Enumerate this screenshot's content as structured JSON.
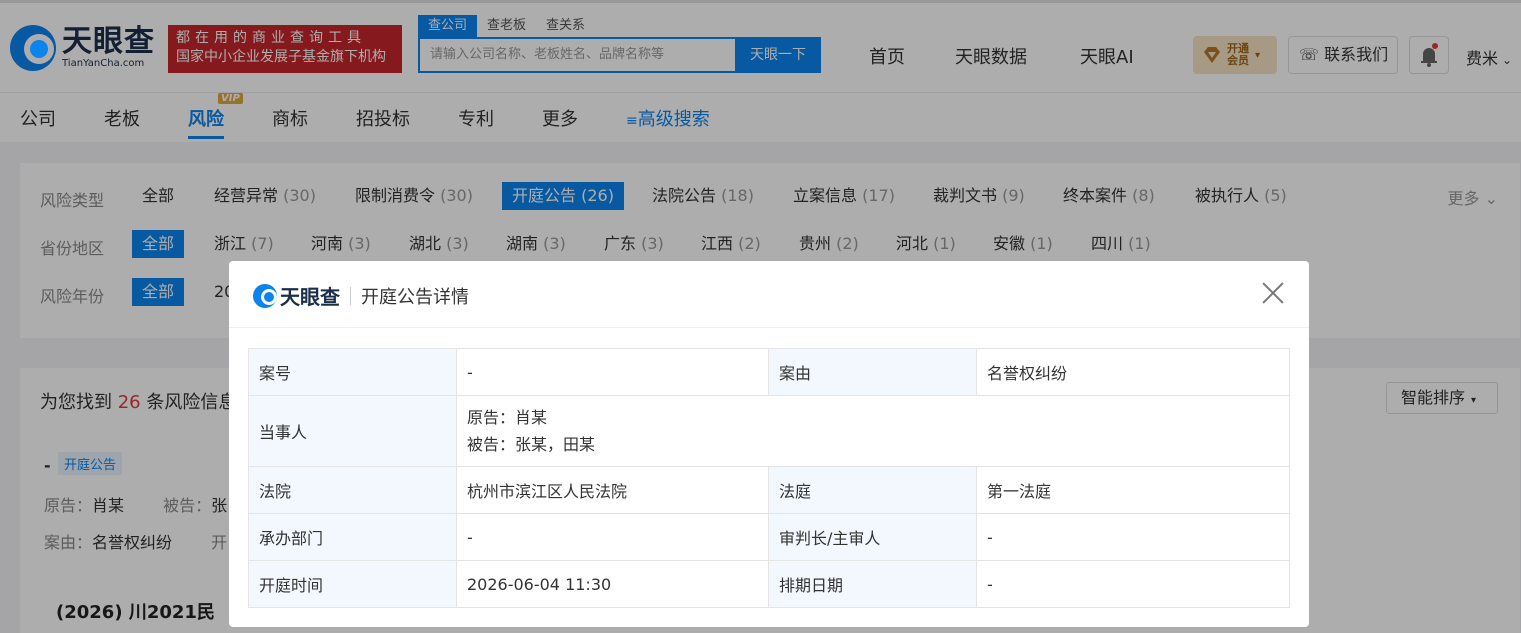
{
  "header": {
    "logo_cn": "天眼查",
    "logo_en": "TianYanCha.com",
    "slogan_line1": "都在用的商业查询工具",
    "slogan_line2": "国家中小企业发展子基金旗下机构",
    "search_tabs": [
      "查公司",
      "查老板",
      "查关系"
    ],
    "search_placeholder": "请输入公司名称、老板姓名、品牌名称等",
    "search_button": "天眼一下",
    "nav": [
      "首页",
      "天眼数据",
      "天眼AI"
    ],
    "vip_line1": "开通",
    "vip_line2": "会员",
    "contact": "联系我们",
    "user": "费米"
  },
  "subnav": {
    "items": [
      "公司",
      "老板",
      "风险",
      "商标",
      "招投标",
      "专利",
      "更多"
    ],
    "active": "风险",
    "vip_badge": "VIP",
    "advanced_search": "高级搜索"
  },
  "filters": {
    "risk_type_label": "风险类型",
    "risk_types": [
      {
        "name": "全部",
        "count": ""
      },
      {
        "name": "经营异常",
        "count": "(30)"
      },
      {
        "name": "限制消费令",
        "count": "(30)"
      },
      {
        "name": "开庭公告",
        "count": "(26)"
      },
      {
        "name": "法院公告",
        "count": "(18)"
      },
      {
        "name": "立案信息",
        "count": "(17)"
      },
      {
        "name": "裁判文书",
        "count": "(9)"
      },
      {
        "name": "终本案件",
        "count": "(8)"
      },
      {
        "name": "被执行人",
        "count": "(5)"
      }
    ],
    "more": "更多",
    "province_label": "省份地区",
    "provinces": [
      {
        "name": "全部",
        "count": ""
      },
      {
        "name": "浙江",
        "count": "(7)"
      },
      {
        "name": "河南",
        "count": "(3)"
      },
      {
        "name": "湖北",
        "count": "(3)"
      },
      {
        "name": "湖南",
        "count": "(3)"
      },
      {
        "name": "广东",
        "count": "(3)"
      },
      {
        "name": "江西",
        "count": "(2)"
      },
      {
        "name": "贵州",
        "count": "(2)"
      },
      {
        "name": "河北",
        "count": "(1)"
      },
      {
        "name": "安徽",
        "count": "(1)"
      },
      {
        "name": "四川",
        "count": "(1)"
      }
    ],
    "year_label": "风险年份",
    "year_all": "全部",
    "year_partial": "20"
  },
  "results": {
    "prefix": "为您找到",
    "count": "26",
    "suffix": "条风险信息",
    "sort": "智能排序",
    "case_tag": "开庭公告",
    "case_dash": "-",
    "plaintiff_label": "原告：",
    "plaintiff": "肖某",
    "defendant_label": "被告：",
    "defendant_partial": "张",
    "cause_label": "案由：",
    "cause": "名誉权纠纷",
    "cause_extra": "开",
    "case_no_partial": "(2026) 川2021民"
  },
  "modal": {
    "logo": "天眼查",
    "title": "开庭公告详情",
    "rows": {
      "case_no_label": "案号",
      "case_no": "-",
      "cause_label": "案由",
      "cause": "名誉权纠纷",
      "parties_label": "当事人",
      "plaintiff": "原告：肖某",
      "defendant": "被告：张某，田某",
      "court_label": "法院",
      "court": "杭州市滨江区人民法院",
      "courtroom_label": "法庭",
      "courtroom": "第一法庭",
      "dept_label": "承办部门",
      "dept": "-",
      "judge_label": "审判长/主审人",
      "judge": "-",
      "time_label": "开庭时间",
      "time": "2026-06-04 11:30",
      "schedule_label": "排期日期",
      "schedule": "-"
    }
  },
  "colors": {
    "brand_blue": "#0b84ee",
    "slogan_red": "#c4262b",
    "count_red": "#e53935"
  }
}
